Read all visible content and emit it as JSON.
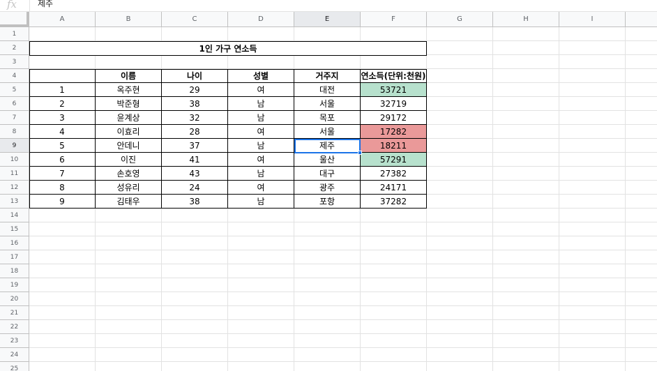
{
  "formula_bar": {
    "fx_label": "fx",
    "value": "제주"
  },
  "colors": {
    "green": "#b7e1cd",
    "red": "#ea9999",
    "selection": "#1a73e8"
  },
  "columns": [
    "A",
    "B",
    "C",
    "D",
    "E",
    "F",
    "G",
    "H",
    "I"
  ],
  "selected_column": "E",
  "rows": [
    "1",
    "2",
    "3",
    "4",
    "5",
    "6",
    "7",
    "8",
    "9",
    "10",
    "11",
    "12",
    "13",
    "14",
    "15",
    "16",
    "17",
    "18",
    "19",
    "20",
    "21",
    "22",
    "23",
    "24",
    "25"
  ],
  "selected_row": "9",
  "sheet": {
    "title": "1인 가구 연소득",
    "headers": [
      "",
      "이름",
      "나이",
      "성별",
      "거주지",
      "연소득(단위:천원)"
    ],
    "records": [
      [
        "1",
        "옥주현",
        "29",
        "여",
        "대전",
        "53721"
      ],
      [
        "2",
        "박준형",
        "38",
        "남",
        "서울",
        "32719"
      ],
      [
        "3",
        "윤계상",
        "32",
        "남",
        "목포",
        "29172"
      ],
      [
        "4",
        "이효리",
        "28",
        "여",
        "서울",
        "17282"
      ],
      [
        "5",
        "안데니",
        "37",
        "남",
        "제주",
        "18211"
      ],
      [
        "6",
        "이진",
        "41",
        "여",
        "울산",
        "57291"
      ],
      [
        "7",
        "손호영",
        "43",
        "남",
        "대구",
        "27382"
      ],
      [
        "8",
        "성유리",
        "24",
        "여",
        "광주",
        "24171"
      ],
      [
        "9",
        "김태우",
        "38",
        "남",
        "포항",
        "37282"
      ]
    ],
    "income_highlight": [
      "green",
      "",
      "",
      "red",
      "red",
      "green",
      "",
      "",
      ""
    ]
  }
}
